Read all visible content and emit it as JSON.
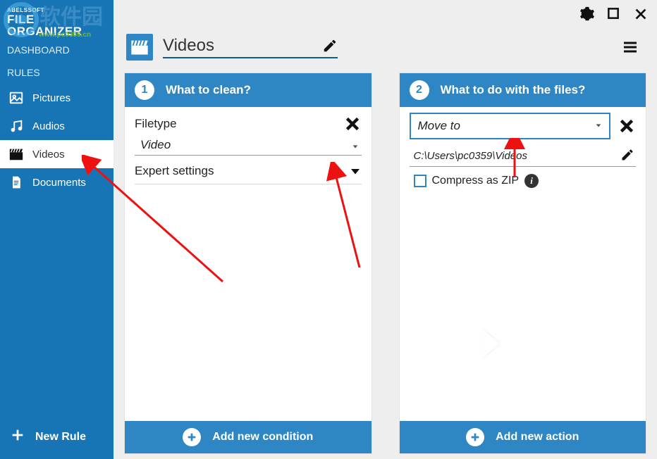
{
  "app": {
    "brand1": "ABELSSOFT",
    "brand2": "FILE ORGANIZER",
    "url": "www.pc0359.cn"
  },
  "sidebar": {
    "dashboard": "DASHBOARD",
    "rules_label": "RULES",
    "items": [
      {
        "label": "Pictures"
      },
      {
        "label": "Audios"
      },
      {
        "label": "Videos"
      },
      {
        "label": "Documents"
      }
    ],
    "new_rule": "New Rule"
  },
  "header": {
    "title": "Videos"
  },
  "panel1": {
    "title": "What to clean?",
    "step": "1",
    "filetype_label": "Filetype",
    "filetype_value": "Video",
    "expert_label": "Expert settings",
    "add_label": "Add new condition"
  },
  "panel2": {
    "title": "What to do with the files?",
    "step": "2",
    "action_value": "Move to",
    "path_value": "C:\\Users\\pc0359\\Videos",
    "zip_label": "Compress as ZIP",
    "add_label": "Add new action"
  }
}
